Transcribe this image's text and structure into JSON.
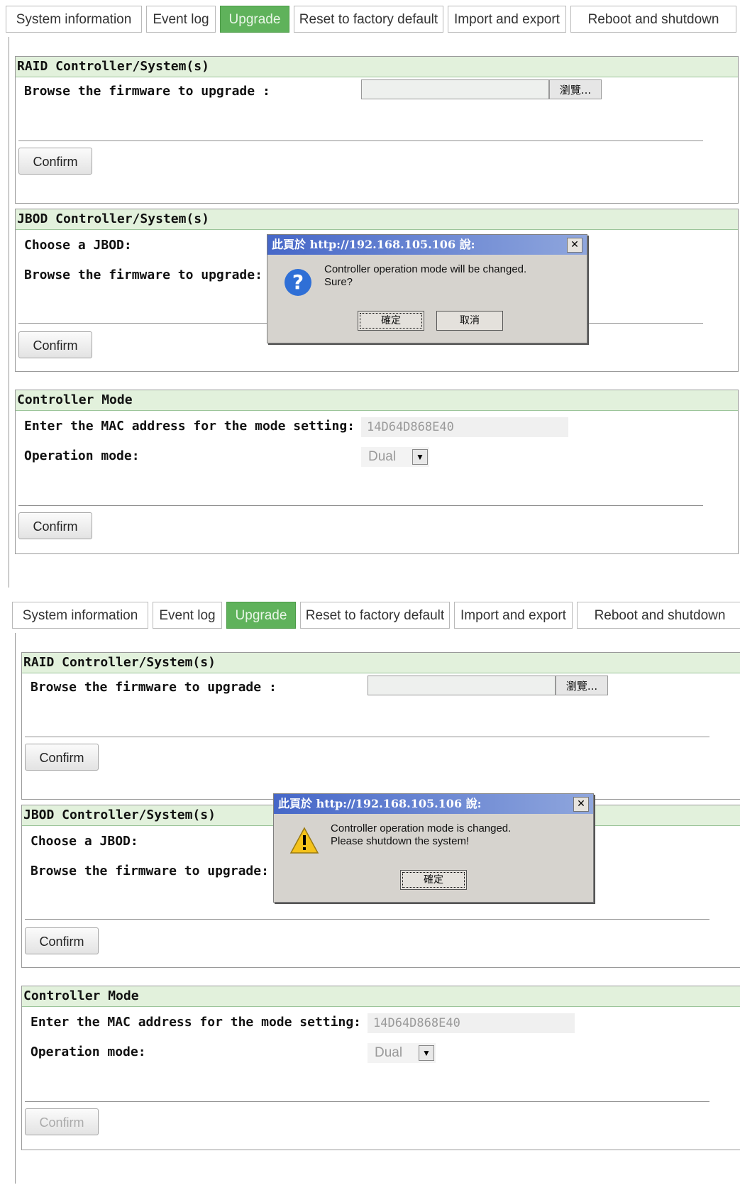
{
  "tabs": [
    "System information",
    "Event log",
    "Upgrade",
    "Reset to factory default",
    "Import and export",
    "Reboot and shutdown"
  ],
  "active_tab": "Upgrade",
  "sections": {
    "raid_title": "RAID Controller/System(s)",
    "raid_browse_label": "Browse the firmware to upgrade :",
    "jbod_title": "JBOD Controller/System(s)",
    "jbod_choose_label": "Choose a JBOD:",
    "jbod_browse_label": "Browse the firmware to upgrade:",
    "mode_title": "Controller Mode",
    "mac_label": "Enter the MAC address for the mode setting:",
    "mac_value": "14D64D868E40",
    "op_label": "Operation mode:",
    "op_value": "Dual"
  },
  "browse_label": "瀏覽...",
  "confirm_label": "Confirm",
  "dialog1": {
    "title": "此頁於 http://192.168.105.106 說:",
    "line1": "Controller operation mode will be changed.",
    "line2": "Sure?",
    "ok": "確定",
    "cancel": "取消"
  },
  "dialog2": {
    "title": "此頁於 http://192.168.105.106 說:",
    "line1": "Controller operation mode is changed.",
    "line2": "Please shutdown the system!",
    "ok": "確定"
  },
  "colors": {
    "active_tab": "#5fb25b",
    "section_header": "#e2f1dc"
  },
  "icons": {
    "dialog1": "question-icon",
    "dialog2": "warning-icon"
  }
}
